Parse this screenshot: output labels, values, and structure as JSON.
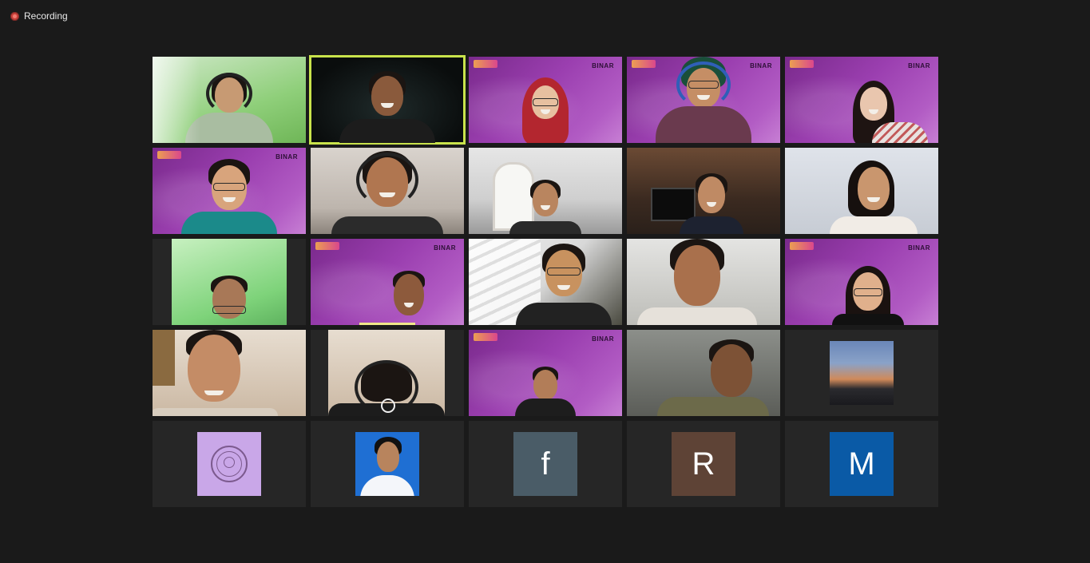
{
  "recording": {
    "label": "Recording",
    "dot_color": "#c8403a"
  },
  "gallery": {
    "active_speaker_color": "#c9e34b",
    "tiles": [
      {
        "kind": "video",
        "bg": "green"
      },
      {
        "kind": "video",
        "bg": "dark",
        "active": true
      },
      {
        "kind": "video",
        "bg": "binar",
        "brand": "BINAR"
      },
      {
        "kind": "video",
        "bg": "binar",
        "brand": "BINAR"
      },
      {
        "kind": "video",
        "bg": "binar",
        "brand": "BINAR"
      },
      {
        "kind": "video",
        "bg": "binar",
        "brand": "BINAR"
      },
      {
        "kind": "video",
        "bg": "room"
      },
      {
        "kind": "video",
        "bg": "hall"
      },
      {
        "kind": "video",
        "bg": "shelf"
      },
      {
        "kind": "video",
        "bg": "wall"
      },
      {
        "kind": "video",
        "bg": "lime",
        "narrow": true
      },
      {
        "kind": "video",
        "bg": "binar",
        "brand": "BINAR",
        "talking": true
      },
      {
        "kind": "video",
        "bg": "stair"
      },
      {
        "kind": "video",
        "bg": "grey"
      },
      {
        "kind": "video",
        "bg": "binar",
        "brand": "BINAR"
      },
      {
        "kind": "video",
        "bg": "warm"
      },
      {
        "kind": "video",
        "bg": "warm",
        "narrow": true
      },
      {
        "kind": "video",
        "bg": "binar",
        "brand": "BINAR"
      },
      {
        "kind": "video",
        "bg": "dim"
      },
      {
        "kind": "avatar",
        "avatar": "street-photo"
      },
      {
        "kind": "avatar",
        "avatar": "lilac-logo"
      },
      {
        "kind": "avatar",
        "avatar": "passport-photo"
      },
      {
        "kind": "avatar",
        "initial": "f",
        "color": "#4a5c67"
      },
      {
        "kind": "avatar",
        "initial": "R",
        "color": "#5e4336"
      },
      {
        "kind": "avatar",
        "initial": "M",
        "color": "#0a5aa6"
      }
    ]
  }
}
